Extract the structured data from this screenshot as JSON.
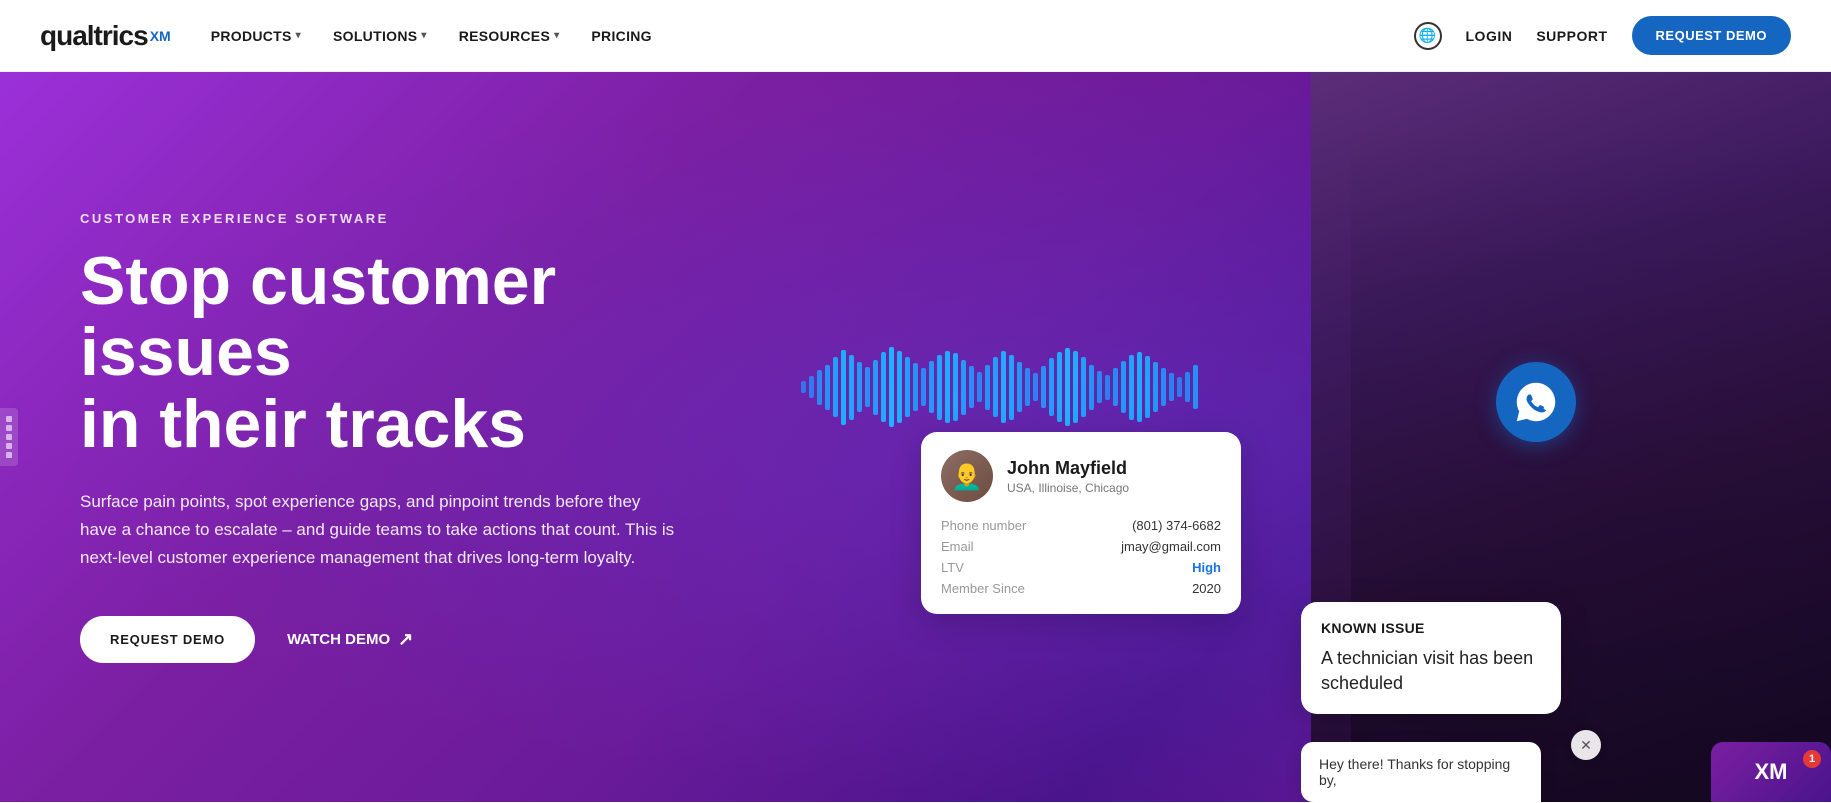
{
  "navbar": {
    "logo_text": "qualtrics",
    "logo_xm": "XM",
    "nav_links": [
      {
        "label": "PRODUCTS",
        "has_dropdown": true
      },
      {
        "label": "SOLUTIONS",
        "has_dropdown": true
      },
      {
        "label": "RESOURCES",
        "has_dropdown": true
      },
      {
        "label": "PRICING",
        "has_dropdown": false
      }
    ],
    "login_label": "LOGIN",
    "support_label": "SUPPORT",
    "request_demo_label": "REQUEST DEMO"
  },
  "hero": {
    "eyebrow": "CUSTOMER EXPERIENCE SOFTWARE",
    "title_line1": "Stop customer issues",
    "title_line2": "in their tracks",
    "subtitle": "Surface pain points, spot experience gaps, and pinpoint trends before they have a chance to escalate – and guide teams to take actions that count. This is next-level customer experience management that drives long-term loyalty.",
    "cta_primary": "REQUEST DEMO",
    "cta_secondary": "WATCH DEMO",
    "cta_arrow": "↗"
  },
  "customer_card": {
    "name": "John Mayfield",
    "location": "USA, Illinoise, Chicago",
    "avatar_emoji": "👨‍🦲",
    "fields": [
      {
        "label": "Phone number",
        "value": "(801) 374-6682"
      },
      {
        "label": "Email",
        "value": "jmay@gmail.com"
      },
      {
        "label": "LTV",
        "value": "High",
        "highlight": true
      },
      {
        "label": "Member Since",
        "value": "2020"
      }
    ]
  },
  "known_issue": {
    "title": "KNOWN ISSUE",
    "text": "A technician visit has been scheduled"
  },
  "chat_bubble": {
    "text": "Hey there! Thanks for stopping by,"
  },
  "chat_widget": {
    "label": "XM",
    "badge": "1"
  },
  "chat_close": {
    "symbol": "✕"
  },
  "wave_bars": [
    12,
    22,
    35,
    45,
    60,
    75,
    65,
    50,
    40,
    55,
    70,
    80,
    72,
    60,
    48,
    38,
    52,
    65,
    72,
    68,
    55,
    42,
    30,
    45,
    60,
    72,
    65,
    50,
    38,
    28,
    42,
    58,
    70,
    78,
    72,
    60,
    45,
    32,
    25,
    38,
    52,
    65,
    70,
    62,
    50,
    38,
    28,
    20,
    30,
    44
  ]
}
